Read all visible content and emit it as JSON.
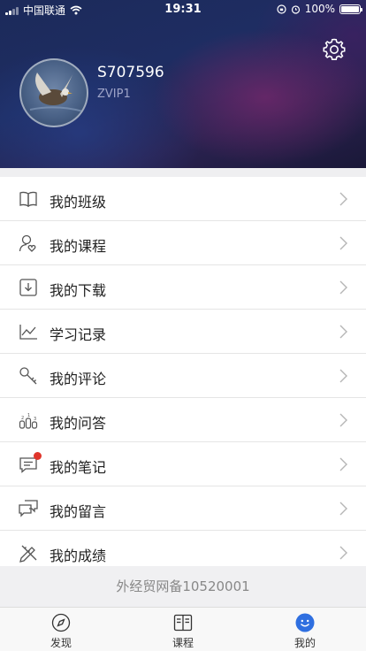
{
  "status_bar": {
    "carrier": "中国联通",
    "time": "19:31",
    "battery": "100%"
  },
  "profile": {
    "username": "S707596",
    "level": "ZVIP1"
  },
  "menu": [
    {
      "label": "我的班级",
      "icon": "book-open-icon"
    },
    {
      "label": "我的课程",
      "icon": "user-heart-icon"
    },
    {
      "label": "我的下载",
      "icon": "download-icon"
    },
    {
      "label": "学习记录",
      "icon": "trend-chart-icon"
    },
    {
      "label": "我的评论",
      "icon": "key-icon"
    },
    {
      "label": "我的问答",
      "icon": "ranking-icon"
    },
    {
      "label": "我的笔记",
      "icon": "chat-bubble-icon",
      "has_badge": true
    },
    {
      "label": "我的留言",
      "icon": "messages-icon"
    },
    {
      "label": "我的成绩",
      "icon": "pencil-ruler-icon"
    }
  ],
  "footer_note": "外经贸网备10520001",
  "tabs": [
    {
      "label": "发现",
      "icon": "compass-icon",
      "active": false
    },
    {
      "label": "课程",
      "icon": "book-icon",
      "active": false
    },
    {
      "label": "我的",
      "icon": "smile-icon",
      "active": true
    }
  ],
  "colors": {
    "accent": "#2f6fe0",
    "badge": "#e0352b",
    "header_dark": "#1c2a5a"
  }
}
